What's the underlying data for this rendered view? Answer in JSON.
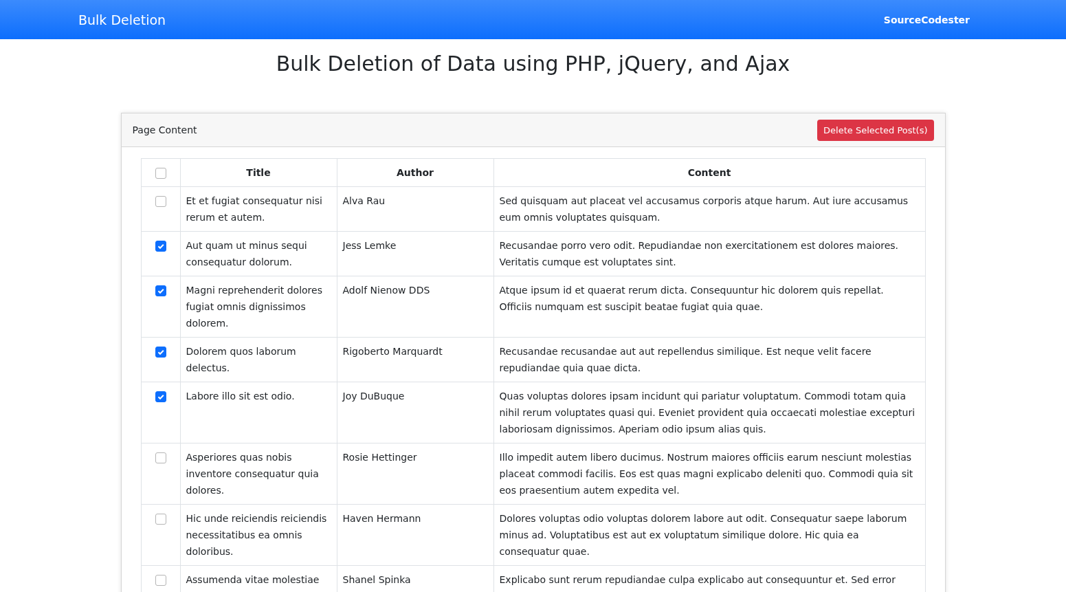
{
  "navbar": {
    "brand": "Bulk Deletion",
    "link": "SourceCodester"
  },
  "heading": "Bulk Deletion of Data using PHP, jQuery, and Ajax",
  "card": {
    "title": "Page Content",
    "delete_button": "Delete Selected Post(s)"
  },
  "table": {
    "select_all": {
      "checked": false
    },
    "columns": [
      "Title",
      "Author",
      "Content"
    ],
    "rows": [
      {
        "checked": false,
        "title": "Et et fugiat consequatur nisi rerum et autem.",
        "author": "Alva Rau",
        "content": "Sed quisquam aut placeat vel accusamus corporis atque harum. Aut iure accusamus eum omnis voluptates quisquam."
      },
      {
        "checked": true,
        "title": "Aut quam ut minus sequi consequatur dolorum.",
        "author": "Jess Lemke",
        "content": "Recusandae porro vero odit. Repudiandae non exercitationem est dolores maiores. Veritatis cumque est voluptates sint."
      },
      {
        "checked": true,
        "title": "Magni reprehenderit dolores fugiat omnis dignissimos dolorem.",
        "author": "Adolf Nienow DDS",
        "content": "Atque ipsum id et quaerat rerum dicta. Consequuntur hic dolorem quis repellat. Officiis numquam est suscipit beatae fugiat quia quae."
      },
      {
        "checked": true,
        "title": "Dolorem quos laborum delectus.",
        "author": "Rigoberto Marquardt",
        "content": "Recusandae recusandae aut aut repellendus similique. Est neque velit facere repudiandae quia quae dicta."
      },
      {
        "checked": true,
        "title": "Labore illo sit est odio.",
        "author": "Joy DuBuque",
        "content": "Quas voluptas dolores ipsam incidunt qui pariatur voluptatum. Commodi totam quia nihil rerum voluptates quasi qui. Eveniet provident quia occaecati molestiae excepturi laboriosam dignissimos. Aperiam odio ipsum alias quis."
      },
      {
        "checked": false,
        "title": "Asperiores quas nobis inventore consequatur quia dolores.",
        "author": "Rosie Hettinger",
        "content": "Illo impedit autem libero ducimus. Nostrum maiores officiis earum nesciunt molestias placeat commodi facilis. Eos est quas magni explicabo deleniti quo. Commodi quia sit eos praesentium autem expedita vel."
      },
      {
        "checked": false,
        "title": "Hic unde reiciendis reiciendis necessitatibus ea omnis doloribus.",
        "author": "Haven Hermann",
        "content": "Dolores voluptas odio voluptas dolorem labore aut odit. Consequatur saepe laborum minus ad. Voluptatibus est aut ex voluptatum similique dolore. Hic quia ea consequatur quae."
      },
      {
        "checked": false,
        "title": "Assumenda vitae molestiae",
        "author": "Shanel Spinka",
        "content": "Explicabo sunt rerum repudiandae culpa explicabo aut consequuntur et. Sed error"
      }
    ]
  }
}
